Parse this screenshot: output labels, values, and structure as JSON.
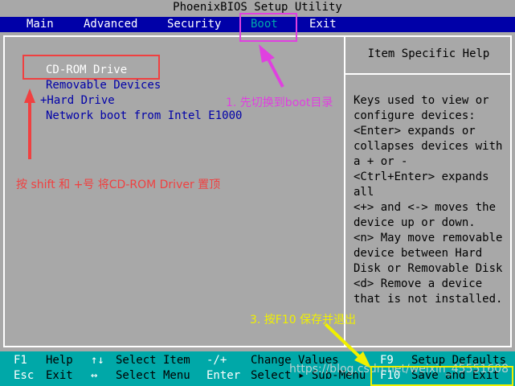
{
  "title": "PhoenixBIOS Setup Utility",
  "menu": [
    {
      "label": "Main"
    },
    {
      "label": "Advanced"
    },
    {
      "label": "Security"
    },
    {
      "label": "Boot",
      "active": true
    },
    {
      "label": "Exit"
    }
  ],
  "boot_order": [
    {
      "label": "CD-ROM Drive",
      "selected": true
    },
    {
      "label": "Removable Devices"
    },
    {
      "label": "+Hard Drive"
    },
    {
      "label": "Network boot from Intel E1000"
    }
  ],
  "help": {
    "title": "Item Specific Help",
    "lines": [
      "Keys used to view or",
      "configure devices:",
      "<Enter> expands or",
      "collapses devices with",
      "a + or -",
      "<Ctrl+Enter> expands",
      "all",
      "<+> and <-> moves the",
      "device up or down.",
      "<n> May move removable",
      "device between Hard",
      "Disk or Removable Disk",
      "<d> Remove a device",
      "that is not installed."
    ]
  },
  "status": {
    "row1": [
      {
        "key": "F1",
        "desc": "Help"
      },
      {
        "key": "↑↓",
        "desc": "Select Item"
      },
      {
        "key": "-/+",
        "desc": "Change Values"
      },
      {
        "key": "F9",
        "desc": "Setup Defaults"
      }
    ],
    "row2": [
      {
        "key": "Esc",
        "desc": "Exit"
      },
      {
        "key": "↔",
        "desc": "Select Menu"
      },
      {
        "key": "Enter",
        "desc": "Select ▸ Sub-Menu"
      },
      {
        "key": "F10",
        "desc": "Save and Exit"
      }
    ]
  },
  "annotations": {
    "step1": "1. 先切换到boot目录",
    "step2": "按 shift 和 +号 将CD-ROM Driver 置顶",
    "step3": "3. 按F10 保存并退出"
  },
  "watermark": "https://blog.csdn.net/weixin_45551608",
  "colors": {
    "menubar": "#0000a8",
    "background": "#a8a8a8",
    "statusbar": "#00a8a8",
    "item_text": "#0000a8",
    "annotation_magenta": "#e040e0",
    "annotation_red": "#f04040",
    "annotation_yellow": "#f0f000"
  }
}
